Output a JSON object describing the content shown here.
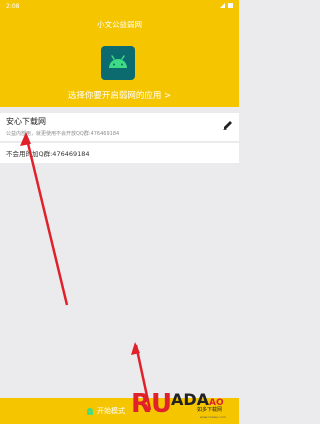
{
  "status_bar": {
    "time": "2:08"
  },
  "app": {
    "title": "小文公益弱网"
  },
  "prompt": {
    "select_app": "选择你要开启弱网的应用 >"
  },
  "list": {
    "items": [
      {
        "title": "安心下载网",
        "subtitle": "公益内部用，就更使用不会开放QQ群:476469184",
        "action_icon": "edit-icon"
      },
      {
        "text": "不会用的加Q群:476469184"
      }
    ]
  },
  "bottom_bar": {
    "start_label": "开始模式"
  },
  "watermark": {
    "text": "如多下载网",
    "sub": "www.rudaac.com"
  },
  "colors": {
    "accent": "#f5c600",
    "icon_bg": "#0c6b6e",
    "arrow": "#e0212b"
  }
}
